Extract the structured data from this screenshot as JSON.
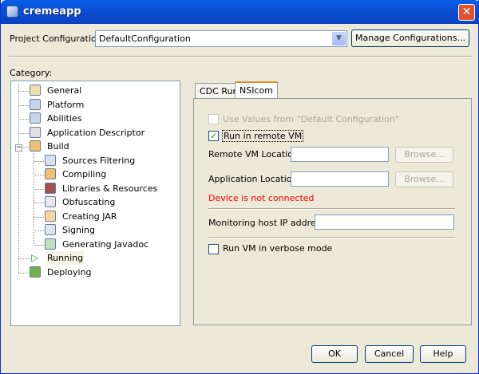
{
  "window": {
    "title": "cremeapp",
    "close": "✕"
  },
  "config": {
    "label": "Project Configuration:",
    "value": "DefaultConfiguration",
    "manage": "Manage Configurations..."
  },
  "category_label": "Category:",
  "tree": [
    "General",
    "Platform",
    "Abilities",
    "Application Descriptor",
    "Build",
    "Sources Filtering",
    "Compiling",
    "Libraries & Resources",
    "Obfuscating",
    "Creating JAR",
    "Signing",
    "Generating Javadoc",
    "Running",
    "Deploying"
  ],
  "tabs": [
    "CDC Run",
    "NSIcom"
  ],
  "form": {
    "use_defaults": "Use Values from \"Default Configuration\"",
    "run_remote": "Run in remote VM",
    "remote_vm_label": "Remote VM Location:",
    "remote_vm_value": "",
    "app_loc_label": "Application Location:",
    "app_loc_value": "",
    "browse": "Browse...",
    "error": "Device is not connected",
    "monitor_label": "Monitoring host IP address:",
    "monitor_value": "",
    "verbose": "Run VM in verbose mode"
  },
  "buttons": {
    "ok": "OK",
    "cancel": "Cancel",
    "help": "Help"
  },
  "colors": {
    "error": "#ff0000",
    "title_bar": "#0b4fd6"
  }
}
